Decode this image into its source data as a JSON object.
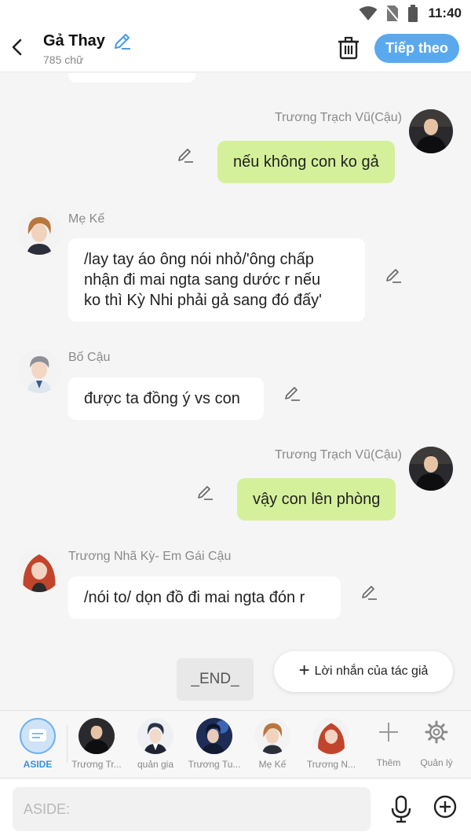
{
  "status": {
    "time": "11:40"
  },
  "header": {
    "title": "Gả Thay",
    "word_count": "785 chữ",
    "next_label": "Tiếp theo"
  },
  "messages": [
    {
      "side": "right",
      "name": "Trương Trạch Vũ(Cậu)",
      "text": "nếu không con ko gả"
    },
    {
      "side": "left",
      "name": "Mẹ Kế",
      "lines": [
        "/lay tay áo ông nói nhỏ/'ông chấp",
        "nhận đi mai ngta sang dước r nếu",
        "ko thì Kỳ Nhi phải gả sang đó đấy'"
      ]
    },
    {
      "side": "left",
      "name": "Bố Cậu",
      "text": "được ta đồng ý vs con"
    },
    {
      "side": "right",
      "name": "Trương Trạch Vũ(Cậu)",
      "text": "vậy con lên phòng"
    },
    {
      "side": "left",
      "name": "Trương Nhã Kỳ- Em Gái Cậu",
      "text": "/nói to/ dọn đồ đi mai ngta đón r"
    }
  ],
  "end_label": "_END_",
  "author_note_label": "Lời nhắn của tác giả",
  "characters": [
    {
      "label": "ASIDE",
      "active": true
    },
    {
      "label": "Trương Tr..."
    },
    {
      "label": "quản gia"
    },
    {
      "label": "Trương Tu..."
    },
    {
      "label": "Mẹ Kế"
    },
    {
      "label": "Trương N..."
    },
    {
      "label": "Thêm",
      "icon": "plus-icon"
    },
    {
      "label": "Quản lý",
      "icon": "gear-icon"
    }
  ],
  "input": {
    "placeholder": "ASIDE:"
  },
  "colors": {
    "accent": "#5aa9ee",
    "bubble_right": "#d5f09b",
    "bubble_left": "#ffffff",
    "active_label": "#3a8fe0"
  }
}
